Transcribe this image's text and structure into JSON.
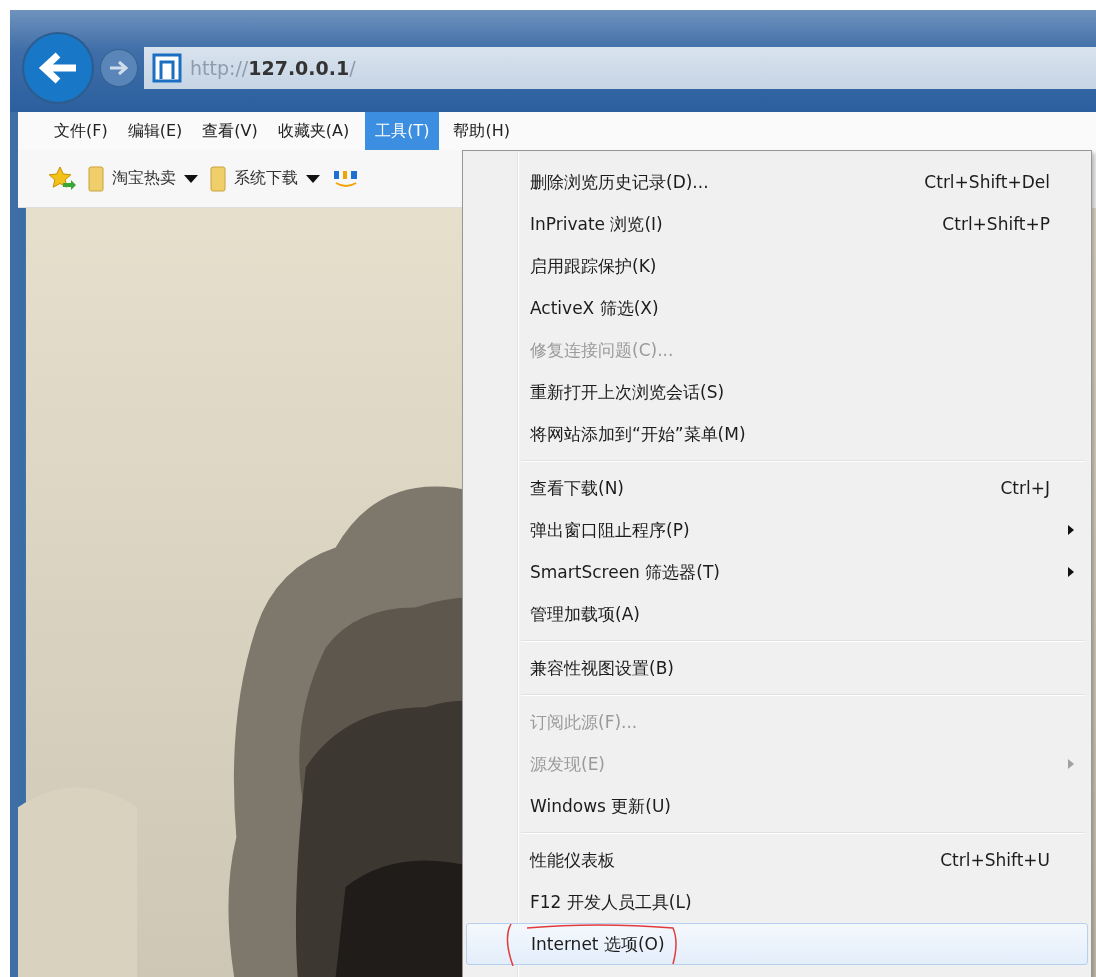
{
  "address_bar": {
    "scheme": "http://",
    "host": "127.0.0.1",
    "path": "/"
  },
  "menu_bar": [
    {
      "label": "文件(F)",
      "selected": false
    },
    {
      "label": "编辑(E)",
      "selected": false
    },
    {
      "label": "查看(V)",
      "selected": false
    },
    {
      "label": "收藏夹(A)",
      "selected": false
    },
    {
      "label": "工具(T)",
      "selected": true
    },
    {
      "label": "帮助(H)",
      "selected": false
    }
  ],
  "favorites_bar": [
    {
      "kind": "folder",
      "label": "淘宝热卖"
    },
    {
      "kind": "folder",
      "label": "系统下载"
    }
  ],
  "tools_menu": [
    {
      "kind": "item",
      "label": "删除浏览历史记录(D)...",
      "shortcut": "Ctrl+Shift+Del",
      "disabled": false,
      "submenu": false,
      "highlighted": false
    },
    {
      "kind": "item",
      "label": "InPrivate 浏览(I)",
      "shortcut": "Ctrl+Shift+P",
      "disabled": false,
      "submenu": false,
      "highlighted": false
    },
    {
      "kind": "item",
      "label": "启用跟踪保护(K)",
      "disabled": false,
      "submenu": false,
      "highlighted": false
    },
    {
      "kind": "item",
      "label": "ActiveX 筛选(X)",
      "disabled": false,
      "submenu": false,
      "highlighted": false
    },
    {
      "kind": "item",
      "label": "修复连接问题(C)...",
      "disabled": true,
      "submenu": false,
      "highlighted": false
    },
    {
      "kind": "item",
      "label": "重新打开上次浏览会话(S)",
      "disabled": false,
      "submenu": false,
      "highlighted": false
    },
    {
      "kind": "item",
      "label": "将网站添加到“开始”菜单(M)",
      "disabled": false,
      "submenu": false,
      "highlighted": false
    },
    {
      "kind": "separator"
    },
    {
      "kind": "item",
      "label": "查看下载(N)",
      "shortcut": "Ctrl+J",
      "disabled": false,
      "submenu": false,
      "highlighted": false
    },
    {
      "kind": "item",
      "label": "弹出窗口阻止程序(P)",
      "disabled": false,
      "submenu": true,
      "highlighted": false
    },
    {
      "kind": "item",
      "label": "SmartScreen 筛选器(T)",
      "disabled": false,
      "submenu": true,
      "highlighted": false
    },
    {
      "kind": "item",
      "label": "管理加载项(A)",
      "disabled": false,
      "submenu": false,
      "highlighted": false
    },
    {
      "kind": "separator"
    },
    {
      "kind": "item",
      "label": "兼容性视图设置(B)",
      "disabled": false,
      "submenu": false,
      "highlighted": false
    },
    {
      "kind": "separator"
    },
    {
      "kind": "item",
      "label": "订阅此源(F)...",
      "disabled": true,
      "submenu": false,
      "highlighted": false
    },
    {
      "kind": "item",
      "label": "源发现(E)",
      "disabled": true,
      "submenu": true,
      "highlighted": false
    },
    {
      "kind": "item",
      "label": "Windows 更新(U)",
      "disabled": false,
      "submenu": false,
      "highlighted": false
    },
    {
      "kind": "separator"
    },
    {
      "kind": "item",
      "label": "性能仪表板",
      "shortcut": "Ctrl+Shift+U",
      "disabled": false,
      "submenu": false,
      "highlighted": false
    },
    {
      "kind": "item",
      "label": "F12 开发人员工具(L)",
      "disabled": false,
      "submenu": false,
      "highlighted": false
    },
    {
      "kind": "item",
      "label": "Internet 选项(O)",
      "disabled": false,
      "submenu": false,
      "highlighted": true,
      "circled": true
    }
  ]
}
